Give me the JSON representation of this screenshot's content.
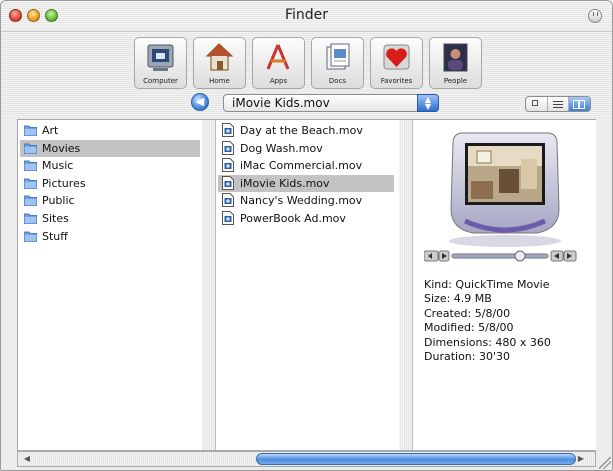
{
  "window": {
    "title": "Finder"
  },
  "toolbar": {
    "buttons": [
      {
        "label": "Computer",
        "icon": "computer-icon"
      },
      {
        "label": "Home",
        "icon": "home-icon"
      },
      {
        "label": "Apps",
        "icon": "apps-icon"
      },
      {
        "label": "Docs",
        "icon": "docs-icon"
      },
      {
        "label": "Favorites",
        "icon": "favorites-icon"
      },
      {
        "label": "People",
        "icon": "people-icon"
      }
    ],
    "path_popup": "iMovie Kids.mov"
  },
  "columns": {
    "folders": [
      {
        "label": "Art",
        "selected": false
      },
      {
        "label": "Movies",
        "selected": true
      },
      {
        "label": "Music",
        "selected": false
      },
      {
        "label": "Pictures",
        "selected": false
      },
      {
        "label": "Public",
        "selected": false
      },
      {
        "label": "Sites",
        "selected": false
      },
      {
        "label": "Stuff",
        "selected": false
      }
    ],
    "files": [
      {
        "label": "Day at the Beach.mov",
        "selected": false
      },
      {
        "label": "Dog Wash.mov",
        "selected": false
      },
      {
        "label": "iMac Commercial.mov",
        "selected": false
      },
      {
        "label": "iMovie Kids.mov",
        "selected": true
      },
      {
        "label": "Nancy's Wedding.mov",
        "selected": false
      },
      {
        "label": "PowerBook Ad.mov",
        "selected": false
      }
    ]
  },
  "preview": {
    "info": [
      "Kind: QuickTime Movie",
      "Size: 4.9 MB",
      "Created: 5/8/00",
      "Modified: 5/8/00",
      "Dimensions: 480 x 360",
      "Duration: 30'30"
    ]
  },
  "colors": {
    "selection": "#c3c3c3",
    "aqua_blue": "#3b7dd6"
  }
}
